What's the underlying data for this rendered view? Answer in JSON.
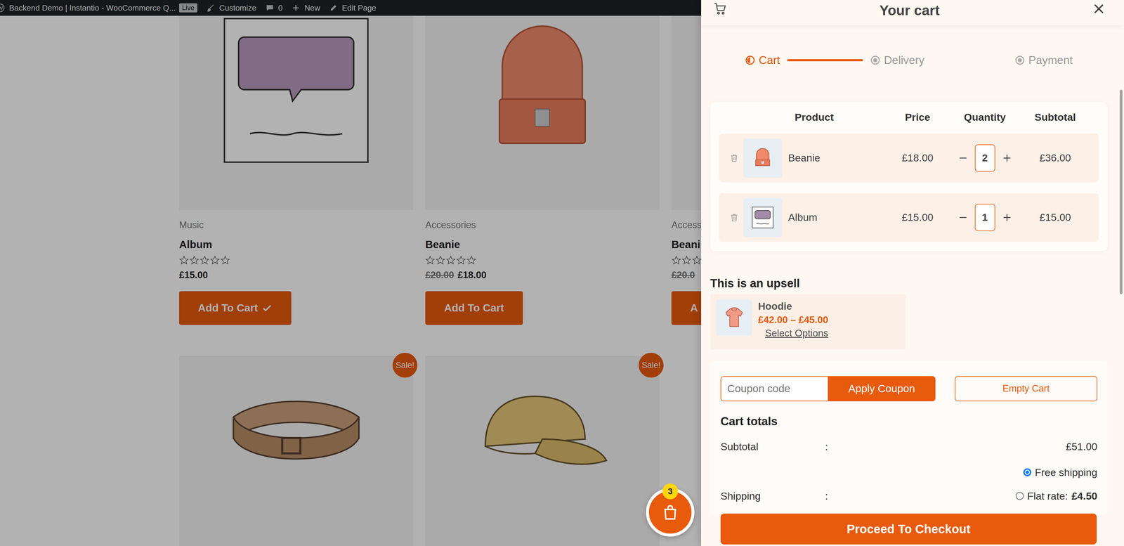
{
  "admin_bar": {
    "site_title": "Backend Demo | Instantio - WooCommerce Q...",
    "live_badge": "Live",
    "items": [
      {
        "label": "Customize"
      },
      {
        "label": "0"
      },
      {
        "label": "New"
      },
      {
        "label": "Edit Page"
      }
    ]
  },
  "products": [
    {
      "category": "Music",
      "name": "Album",
      "stars": 0,
      "price": "£15.00",
      "button": "Add To Cart",
      "added": true
    },
    {
      "category": "Accessories",
      "name": "Beanie",
      "stars": 0,
      "old_price": "£20.00",
      "price": "£18.00",
      "button": "Add To Cart",
      "added": false
    },
    {
      "category": "Access",
      "name": "Beani",
      "stars": 0,
      "old_price": "£20.0",
      "button": "A",
      "added": false
    }
  ],
  "sale_products": [
    {
      "badge": "Sale!"
    },
    {
      "badge": "Sale!"
    }
  ],
  "cart_fab": {
    "count": "3"
  },
  "drawer": {
    "title": "Your cart"
  },
  "steps": [
    {
      "label": "Cart",
      "selected": true
    },
    {
      "label": "Delivery",
      "selected": false
    },
    {
      "label": "Payment",
      "selected": false
    }
  ],
  "cart_table": {
    "columns": [
      "Product",
      "Price",
      "Quantity",
      "Subtotal"
    ],
    "rows": [
      {
        "name": "Beanie",
        "price": "£18.00",
        "quantity": "2",
        "subtotal": "£36.00"
      },
      {
        "name": "Album",
        "price": "£15.00",
        "quantity": "1",
        "subtotal": "£15.00"
      }
    ]
  },
  "upsell": {
    "title": "This is an upsell",
    "items": [
      {
        "name": "Hoodie",
        "price": "£42.00 – £45.00",
        "action": "Select Options"
      }
    ]
  },
  "coupon": {
    "placeholder": "Coupon code",
    "apply": "Apply Coupon",
    "empty": "Empty Cart"
  },
  "totals": {
    "title": "Cart totals",
    "subtotal": {
      "label": "Subtotal",
      "sep": ":",
      "value": "£51.00"
    },
    "shipping": {
      "label": "Shipping",
      "sep": ":",
      "options": [
        {
          "label": "Free shipping",
          "selected": true
        },
        {
          "label": "Flat rate:",
          "amount": "£4.50",
          "selected": false
        }
      ]
    }
  },
  "checkout": {
    "label": "Proceed To Checkout"
  }
}
